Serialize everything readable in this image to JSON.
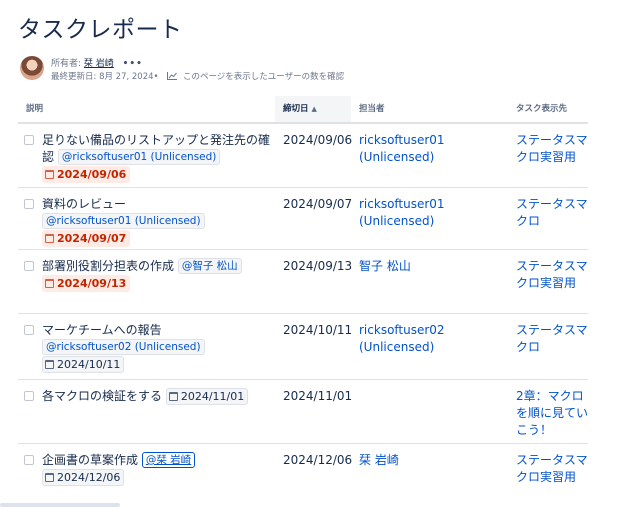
{
  "page": {
    "title": "タスクレポート",
    "owner_label": "所有者:",
    "owner_name": "栞 岩崎",
    "more": "•••",
    "last_updated": "最終更新日: 8月 27, 2024",
    "viewers_link": "このページを表示したユーザーの数を確認"
  },
  "table": {
    "headers": {
      "description": "説明",
      "due_date": "締切日",
      "assignee": "担当者",
      "location": "タスク表示先"
    },
    "sort_indicator": "▲",
    "rows": [
      {
        "task": "足りない備品のリストアップと発注先の確認",
        "mention": "@ricksoftuser01 (Unlicensed)",
        "date_chip": "2024/09/06",
        "date_overdue": true,
        "due": "2024/09/06",
        "assignee": "ricksoftuser01 (Unlicensed)",
        "location": "ステータスマクロ実習用"
      },
      {
        "task": "資料のレビュー",
        "mention": "@ricksoftuser01 (Unlicensed)",
        "date_chip": "2024/09/07",
        "date_overdue": true,
        "due": "2024/09/07",
        "assignee": "ricksoftuser01 (Unlicensed)",
        "location": "ステータスマクロ"
      },
      {
        "task": "部署別役割分担表の作成",
        "mention": "@智子 松山",
        "date_chip": "2024/09/13",
        "date_overdue": true,
        "due": "2024/09/13",
        "assignee": "智子 松山",
        "location": "ステータスマクロ実習用"
      },
      {
        "task": "マーケチームへの報告",
        "mention": "@ricksoftuser02 (Unlicensed)",
        "date_chip": "2024/10/11",
        "date_overdue": false,
        "due": "2024/10/11",
        "assignee": "ricksoftuser02 (Unlicensed)",
        "location": "ステータスマクロ"
      },
      {
        "task": "各マクロの検証をする",
        "mention": "",
        "date_chip": "2024/11/01",
        "date_overdue": false,
        "due": "2024/11/01",
        "assignee": "",
        "location": "2章：マクロを順に見ていこう！"
      },
      {
        "task": "企画書の草案作成",
        "mention": "@栞 岩崎",
        "date_chip": "2024/12/06",
        "date_overdue": false,
        "due": "2024/12/06",
        "assignee": "栞 岩崎",
        "location": "ステータスマクロ実習用"
      }
    ]
  }
}
